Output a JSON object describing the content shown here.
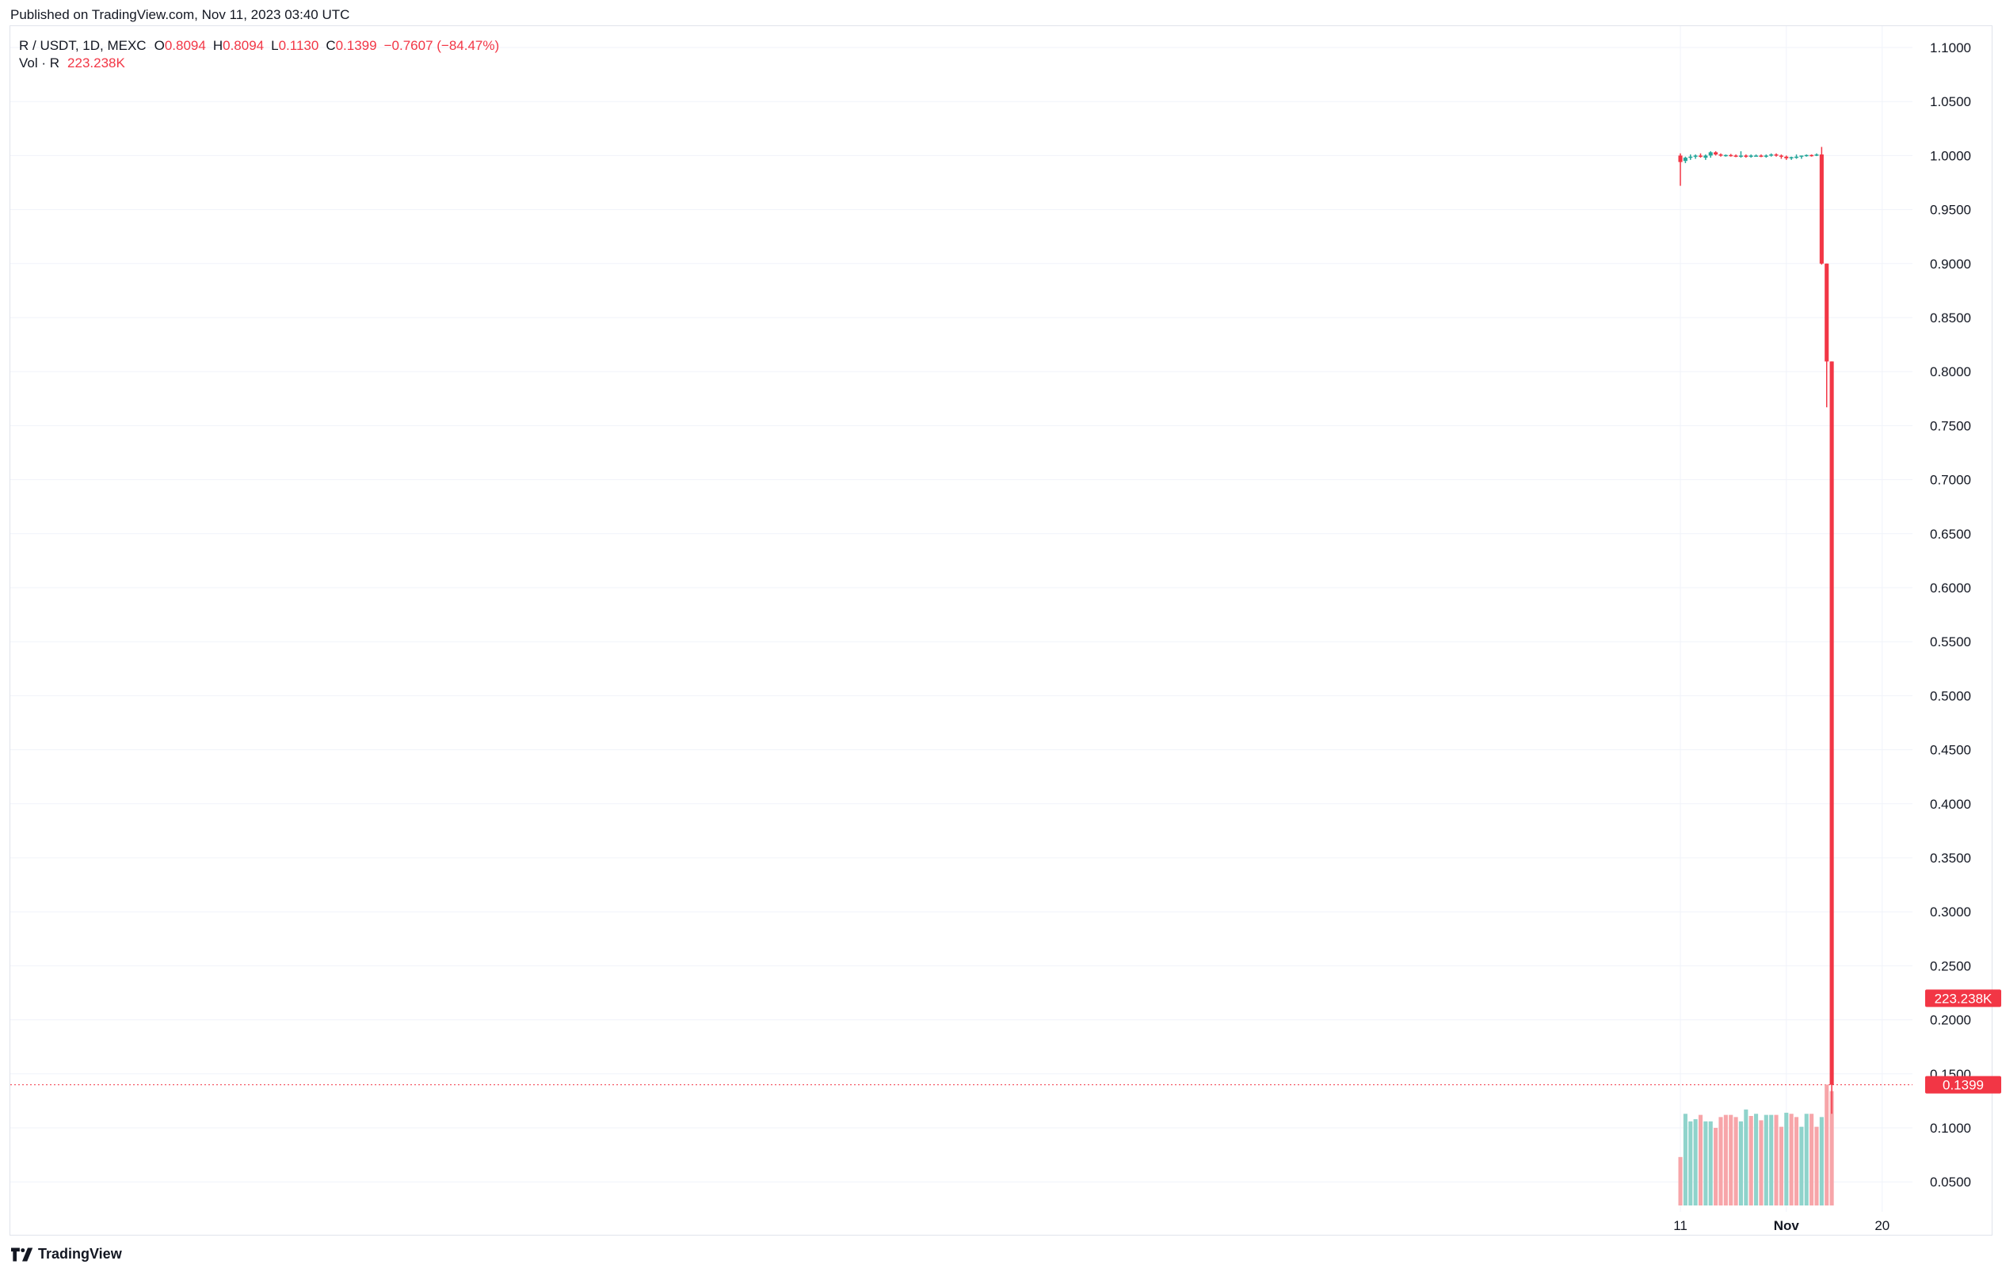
{
  "header": {
    "published": "Published on TradingView.com, Nov 11, 2023 03:40 UTC"
  },
  "legend": {
    "symbol": "R / USDT, 1D, MEXC",
    "open_label": "O",
    "open": "0.8094",
    "high_label": "H",
    "high": "0.8094",
    "low_label": "L",
    "low": "0.1130",
    "close_label": "C",
    "close": "0.1399",
    "change": "−0.7607 (−84.47%)",
    "vol_label": "Vol · R",
    "vol_value": "223.238K"
  },
  "footer": {
    "brand": "TradingView",
    "logo_icon": "tradingview-logo-icon"
  },
  "colors": {
    "up": "#26a69a",
    "down": "#f23645",
    "vol_up": "#8fd3cb",
    "vol_down": "#f7a5a9",
    "grid": "#f0f3fa",
    "axis_text": "#131722"
  },
  "chart_data": {
    "type": "candlestick",
    "title": "R / USDT, 1D, MEXC",
    "ylim": [
      0.025,
      1.1125
    ],
    "y_ticks": [
      "1.1000",
      "1.0500",
      "1.0000",
      "0.9500",
      "0.9000",
      "0.8500",
      "0.8000",
      "0.7500",
      "0.7000",
      "0.6500",
      "0.6000",
      "0.5500",
      "0.5000",
      "0.4500",
      "0.4000",
      "0.3500",
      "0.3000",
      "0.2500",
      "0.2000",
      "0.1500",
      "0.1000",
      "0.0500"
    ],
    "x_ticks": [
      {
        "label": "11",
        "day": 11,
        "bold": false
      },
      {
        "label": "Nov",
        "day": 32,
        "bold": true
      },
      {
        "label": "20",
        "day": 51,
        "bold": false
      }
    ],
    "x_range_days": [
      -320,
      57
    ],
    "x_date_reference": "Oct 2023",
    "last_price_label": "0.1399",
    "volume_price_label": "223.238K",
    "last_price": 0.1399,
    "volume_axis_value": 0.22,
    "candles": [
      {
        "day": 11,
        "o": 1.0,
        "h": 1.002,
        "l": 0.972,
        "c": 0.994
      },
      {
        "day": 12,
        "o": 0.995,
        "h": 0.999,
        "l": 0.993,
        "c": 0.998
      },
      {
        "day": 13,
        "o": 0.998,
        "h": 1.001,
        "l": 0.996,
        "c": 0.999
      },
      {
        "day": 14,
        "o": 0.999,
        "h": 1.001,
        "l": 0.997,
        "c": 1.0
      },
      {
        "day": 15,
        "o": 1.0,
        "h": 1.002,
        "l": 0.998,
        "c": 0.9995
      },
      {
        "day": 16,
        "o": 0.998,
        "h": 1.001,
        "l": 0.996,
        "c": 1.0
      },
      {
        "day": 17,
        "o": 1.0,
        "h": 1.004,
        "l": 0.998,
        "c": 1.003
      },
      {
        "day": 18,
        "o": 1.003,
        "h": 1.004,
        "l": 1.0,
        "c": 1.001
      },
      {
        "day": 19,
        "o": 1.001,
        "h": 1.002,
        "l": 0.999,
        "c": 1.0
      },
      {
        "day": 20,
        "o": 1.0,
        "h": 1.001,
        "l": 0.999,
        "c": 1.0005
      },
      {
        "day": 21,
        "o": 1.0005,
        "h": 1.0015,
        "l": 0.999,
        "c": 1.0
      },
      {
        "day": 22,
        "o": 1.0,
        "h": 1.001,
        "l": 0.9985,
        "c": 0.999
      },
      {
        "day": 23,
        "o": 0.999,
        "h": 1.004,
        "l": 0.998,
        "c": 1.0
      },
      {
        "day": 24,
        "o": 1.0,
        "h": 1.001,
        "l": 0.998,
        "c": 0.999
      },
      {
        "day": 25,
        "o": 0.999,
        "h": 1.001,
        "l": 0.998,
        "c": 1.0
      },
      {
        "day": 26,
        "o": 1.0,
        "h": 1.001,
        "l": 0.999,
        "c": 1.0
      },
      {
        "day": 27,
        "o": 1.0,
        "h": 1.001,
        "l": 0.9985,
        "c": 0.9995
      },
      {
        "day": 28,
        "o": 0.9995,
        "h": 1.001,
        "l": 0.998,
        "c": 1.0
      },
      {
        "day": 29,
        "o": 1.0,
        "h": 1.002,
        "l": 0.999,
        "c": 1.001
      },
      {
        "day": 30,
        "o": 1.001,
        "h": 1.002,
        "l": 0.999,
        "c": 1.0
      },
      {
        "day": 31,
        "o": 1.0,
        "h": 1.001,
        "l": 0.997,
        "c": 0.999
      },
      {
        "day": 32,
        "o": 0.999,
        "h": 1.0,
        "l": 0.996,
        "c": 0.9975
      },
      {
        "day": 33,
        "o": 0.9975,
        "h": 0.999,
        "l": 0.996,
        "c": 0.9985
      },
      {
        "day": 34,
        "o": 0.9985,
        "h": 1.001,
        "l": 0.997,
        "c": 0.999
      },
      {
        "day": 35,
        "o": 0.999,
        "h": 1.0,
        "l": 0.997,
        "c": 1.0
      },
      {
        "day": 36,
        "o": 1.0,
        "h": 1.001,
        "l": 0.999,
        "c": 1.0005
      },
      {
        "day": 37,
        "o": 1.0005,
        "h": 1.001,
        "l": 0.999,
        "c": 1.0
      },
      {
        "day": 38,
        "o": 1.0,
        "h": 1.002,
        "l": 0.9995,
        "c": 1.001
      },
      {
        "day": 39,
        "o": 1.001,
        "h": 1.008,
        "l": 0.899,
        "c": 0.9
      },
      {
        "day": 40,
        "o": 0.9,
        "h": 0.9,
        "l": 0.767,
        "c": 0.8094
      },
      {
        "day": 41,
        "o": 0.8094,
        "h": 0.8094,
        "l": 0.113,
        "c": 0.1399
      }
    ],
    "volume": [
      {
        "day": 11,
        "value": 0.073,
        "up": false
      },
      {
        "day": 12,
        "value": 0.113,
        "up": true
      },
      {
        "day": 13,
        "value": 0.106,
        "up": true
      },
      {
        "day": 14,
        "value": 0.108,
        "up": true
      },
      {
        "day": 15,
        "value": 0.112,
        "up": false
      },
      {
        "day": 16,
        "value": 0.106,
        "up": true
      },
      {
        "day": 17,
        "value": 0.106,
        "up": true
      },
      {
        "day": 18,
        "value": 0.1,
        "up": false
      },
      {
        "day": 19,
        "value": 0.11,
        "up": false
      },
      {
        "day": 20,
        "value": 0.112,
        "up": false
      },
      {
        "day": 21,
        "value": 0.112,
        "up": false
      },
      {
        "day": 22,
        "value": 0.11,
        "up": false
      },
      {
        "day": 23,
        "value": 0.106,
        "up": true
      },
      {
        "day": 24,
        "value": 0.117,
        "up": true
      },
      {
        "day": 25,
        "value": 0.111,
        "up": false
      },
      {
        "day": 26,
        "value": 0.113,
        "up": true
      },
      {
        "day": 27,
        "value": 0.107,
        "up": false
      },
      {
        "day": 28,
        "value": 0.112,
        "up": true
      },
      {
        "day": 29,
        "value": 0.112,
        "up": true
      },
      {
        "day": 30,
        "value": 0.112,
        "up": false
      },
      {
        "day": 31,
        "value": 0.101,
        "up": false
      },
      {
        "day": 32,
        "value": 0.114,
        "up": true
      },
      {
        "day": 33,
        "value": 0.113,
        "up": false
      },
      {
        "day": 34,
        "value": 0.11,
        "up": false
      },
      {
        "day": 35,
        "value": 0.101,
        "up": true
      },
      {
        "day": 36,
        "value": 0.113,
        "up": true
      },
      {
        "day": 37,
        "value": 0.113,
        "up": false
      },
      {
        "day": 38,
        "value": 0.101,
        "up": false
      },
      {
        "day": 39,
        "value": 0.11,
        "up": true
      },
      {
        "day": 40,
        "value": 0.14,
        "up": false
      },
      {
        "day": 41,
        "value": 0.134,
        "up": false
      }
    ]
  }
}
